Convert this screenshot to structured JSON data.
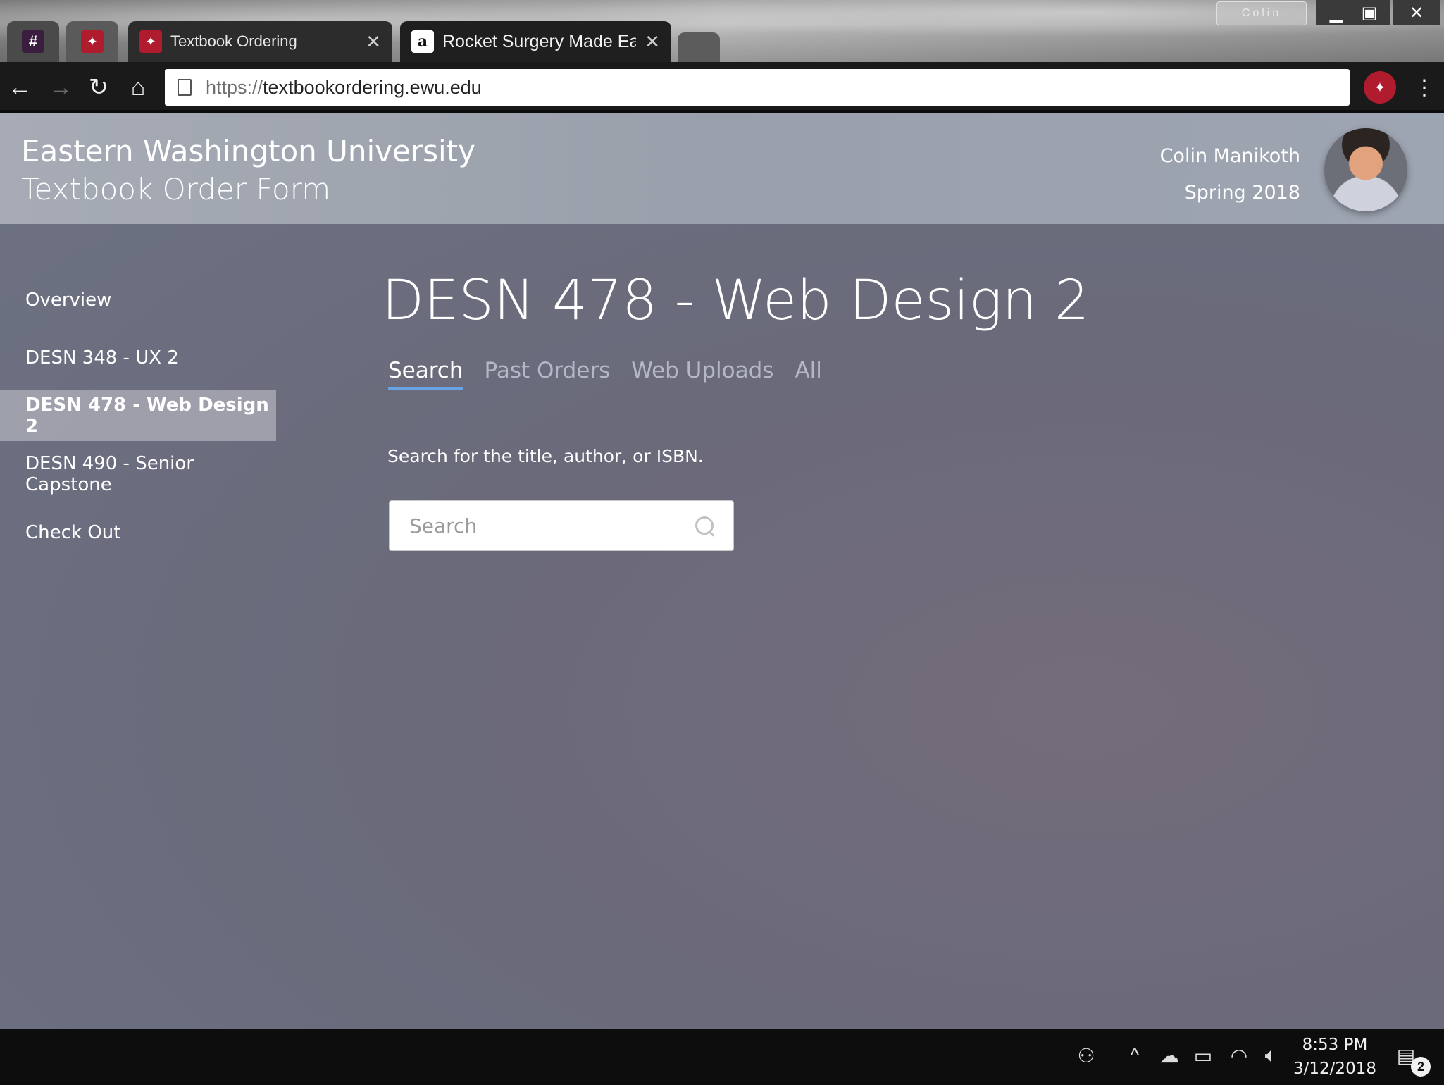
{
  "browser": {
    "tabs": [
      {
        "label": "",
        "favicon": "slack-icon",
        "glyph": "#"
      },
      {
        "label": "",
        "favicon": "ewu-eagle-icon",
        "glyph": "✦"
      },
      {
        "label": "Textbook Ordering",
        "favicon": "ewu-eagle-icon",
        "glyph": "✦"
      },
      {
        "label": "Rocket Surgery Made Ea",
        "favicon": "amazon-icon",
        "glyph": "a"
      }
    ],
    "profile_chip": "Colin",
    "url_scheme": "https://",
    "url_host": "textbookordering.ewu.edu"
  },
  "header": {
    "university": "Eastern Washington University",
    "form_title": "Textbook Order Form",
    "user_name": "Colin Manikoth",
    "term": "Spring 2018"
  },
  "sidebar": {
    "items": [
      {
        "label": "Overview",
        "active": false
      },
      {
        "label": "DESN 348 - UX 2",
        "active": false
      },
      {
        "label": "DESN 478 - Web Design 2",
        "active": true
      },
      {
        "label": "DESN 490 - Senior Capstone",
        "active": false
      },
      {
        "label": "Check Out",
        "active": false
      }
    ]
  },
  "main": {
    "course_title": "DESN 478 - Web Design 2",
    "tabs": [
      {
        "label": "Search",
        "active": true
      },
      {
        "label": "Past Orders",
        "active": false
      },
      {
        "label": "Web Uploads",
        "active": false
      },
      {
        "label": "All",
        "active": false
      }
    ],
    "hint": "Search for the title, author, or ISBN.",
    "search": {
      "placeholder": "Search",
      "value": ""
    }
  },
  "taskbar": {
    "time": "8:53 PM",
    "date": "3/12/2018",
    "notifications": "2"
  },
  "colors": {
    "accent_underline": "#6aa2e6",
    "ewu_red": "#b01b2e"
  }
}
